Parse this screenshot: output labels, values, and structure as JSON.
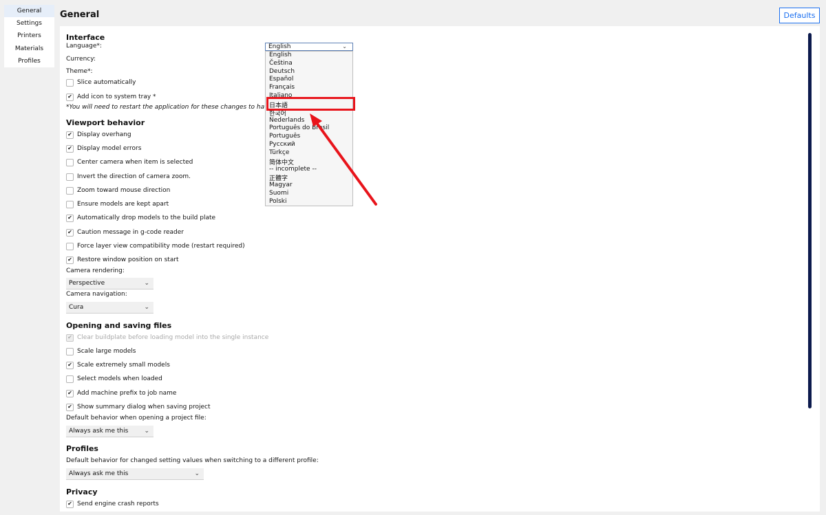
{
  "sidebar": {
    "items": [
      {
        "label": "General"
      },
      {
        "label": "Settings"
      },
      {
        "label": "Printers"
      },
      {
        "label": "Materials"
      },
      {
        "label": "Profiles"
      }
    ]
  },
  "header": {
    "title": "General",
    "defaults_label": "Defaults"
  },
  "interface": {
    "title": "Interface",
    "language_label": "Language*:",
    "currency_label": "Currency:",
    "theme_label": "Theme*:",
    "slice_auto": "Slice automatically",
    "tray_icon": "Add icon to system tray *",
    "restart_note": "*You will need to restart the application for these changes to have ef"
  },
  "language_dropdown": {
    "selected": "English",
    "options": [
      "English",
      "Čeština",
      "Deutsch",
      "Español",
      "Français",
      "Italiano",
      "日本語",
      "한국어",
      "Nederlands",
      "Português do Brasil",
      "Português",
      "Русский",
      "Türkçe",
      "简体中文",
      "-- incomplete --",
      "正體字",
      "Magyar",
      "Suomi",
      "Polski"
    ]
  },
  "viewport": {
    "title": "Viewport behavior",
    "items": [
      {
        "label": "Display overhang",
        "checked": "✔"
      },
      {
        "label": "Display model errors",
        "checked": "✔"
      },
      {
        "label": "Center camera when item is selected",
        "checked": ""
      },
      {
        "label": "Invert the direction of camera zoom.",
        "checked": ""
      },
      {
        "label": "Zoom toward mouse direction",
        "checked": ""
      },
      {
        "label": "Ensure models are kept apart",
        "checked": ""
      },
      {
        "label": "Automatically drop models to the build plate",
        "checked": "✔"
      },
      {
        "label": "Caution message in g-code reader",
        "checked": "✔"
      },
      {
        "label": "Force layer view compatibility mode (restart required)",
        "checked": ""
      },
      {
        "label": "Restore window position on start",
        "checked": "✔"
      }
    ],
    "camera_rendering_label": "Camera rendering:",
    "camera_rendering_value": "Perspective",
    "camera_navigation_label": "Camera navigation:",
    "camera_navigation_value": "Cura"
  },
  "files": {
    "title": "Opening and saving files",
    "items": [
      {
        "label": "Clear buildplate before loading model into the single instance",
        "checked": "✔"
      },
      {
        "label": "Scale large models",
        "checked": ""
      },
      {
        "label": "Scale extremely small models",
        "checked": "✔"
      },
      {
        "label": "Select models when loaded",
        "checked": ""
      },
      {
        "label": "Add machine prefix to job name",
        "checked": "✔"
      },
      {
        "label": "Show summary dialog when saving project",
        "checked": "✔"
      }
    ],
    "project_behavior_label": "Default behavior when opening a project file:",
    "project_behavior_value": "Always ask me this"
  },
  "profiles": {
    "title": "Profiles",
    "changed_label": "Default behavior for changed setting values when switching to a different profile:",
    "changed_value": "Always ask me this"
  },
  "privacy": {
    "title": "Privacy",
    "crash_reports": {
      "label": "Send engine crash reports",
      "checked": "✔"
    }
  },
  "icons": {
    "chevron": "chevron-down-icon",
    "check": "check-icon"
  },
  "colors": {
    "accent": "#196ef0",
    "highlight": "#e8141b",
    "scrollbar": "#0c1a4d"
  }
}
